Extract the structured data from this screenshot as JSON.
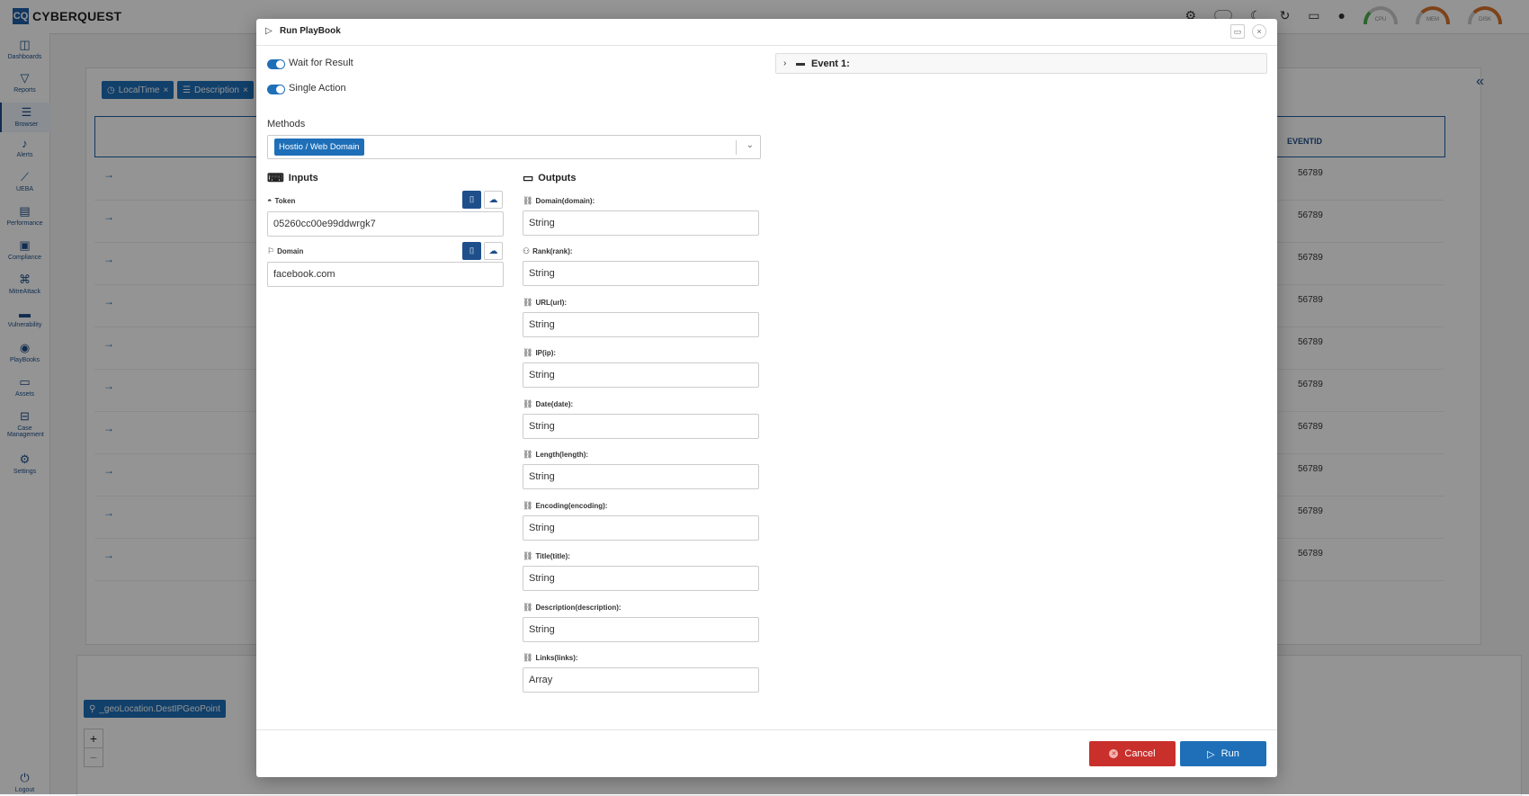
{
  "app": {
    "logo_abbr": "CQ",
    "logo_name": "CYBERQUEST"
  },
  "topbar": {
    "gauges": [
      {
        "label": "CPU",
        "color": "green"
      },
      {
        "label": "MEM",
        "color": "orange"
      },
      {
        "label": "DISK",
        "color": "orange"
      }
    ]
  },
  "sidebar": {
    "items": [
      {
        "label": "Dashboards",
        "icon": "chart-icon"
      },
      {
        "label": "Reports",
        "icon": "filter-icon"
      },
      {
        "label": "Browser",
        "icon": "list-icon"
      },
      {
        "label": "Alerts",
        "icon": "bell-icon"
      },
      {
        "label": "UEBA",
        "icon": "trend-icon"
      },
      {
        "label": "Performance",
        "icon": "gauge-icon"
      },
      {
        "label": "Compliance",
        "icon": "compliance-icon"
      },
      {
        "label": "MitreAttack",
        "icon": "command-icon"
      },
      {
        "label": "Vulnerability",
        "icon": "vulnerability-icon"
      },
      {
        "label": "PlayBooks",
        "icon": "playbook-icon"
      },
      {
        "label": "Assets",
        "icon": "laptop-icon"
      },
      {
        "label": "Case Management",
        "icon": "briefcase-icon"
      },
      {
        "label": "Settings",
        "icon": "gear-icon"
      }
    ],
    "logout": "Logout"
  },
  "background": {
    "chips": [
      {
        "label": "LocalTime"
      },
      {
        "label": "Description"
      }
    ],
    "column_header": "EVENTID",
    "row_values": [
      "56789",
      "56789",
      "56789",
      "56789",
      "56789",
      "56789",
      "56789",
      "56789",
      "56789",
      "56789"
    ],
    "bottom_chip": "_geoLocation.DestIPGeoPoint",
    "zoom_in": "+",
    "zoom_out": "−"
  },
  "modal": {
    "title": "Run PlayBook",
    "toggles": [
      {
        "label": "Wait for Result",
        "on": true
      },
      {
        "label": "Single Action",
        "on": true
      }
    ],
    "methods_label": "Methods",
    "method_selected": "Hostio / Web Domain",
    "inputs_title": "Inputs",
    "inputs": [
      {
        "label": "Token",
        "value": "05260cc00e99ddwrgk7"
      },
      {
        "label": "Domain",
        "value": "facebook.com"
      }
    ],
    "outputs_title": "Outputs",
    "outputs": [
      {
        "label": "Domain(domain):",
        "value": "String"
      },
      {
        "label": "Rank(rank):",
        "value": "String"
      },
      {
        "label": "URL(url):",
        "value": "String"
      },
      {
        "label": "IP(ip):",
        "value": "String"
      },
      {
        "label": "Date(date):",
        "value": "String"
      },
      {
        "label": "Length(length):",
        "value": "String"
      },
      {
        "label": "Encoding(encoding):",
        "value": "String"
      },
      {
        "label": "Title(title):",
        "value": "String"
      },
      {
        "label": "Description(description):",
        "value": "String"
      },
      {
        "label": "Links(links):",
        "value": "Array"
      }
    ],
    "event_label": "Event 1:",
    "cancel_label": "Cancel",
    "run_label": "Run"
  },
  "colors": {
    "primary": "#1e6fb8",
    "dark_primary": "#1e4f8a",
    "danger": "#c9302c"
  }
}
